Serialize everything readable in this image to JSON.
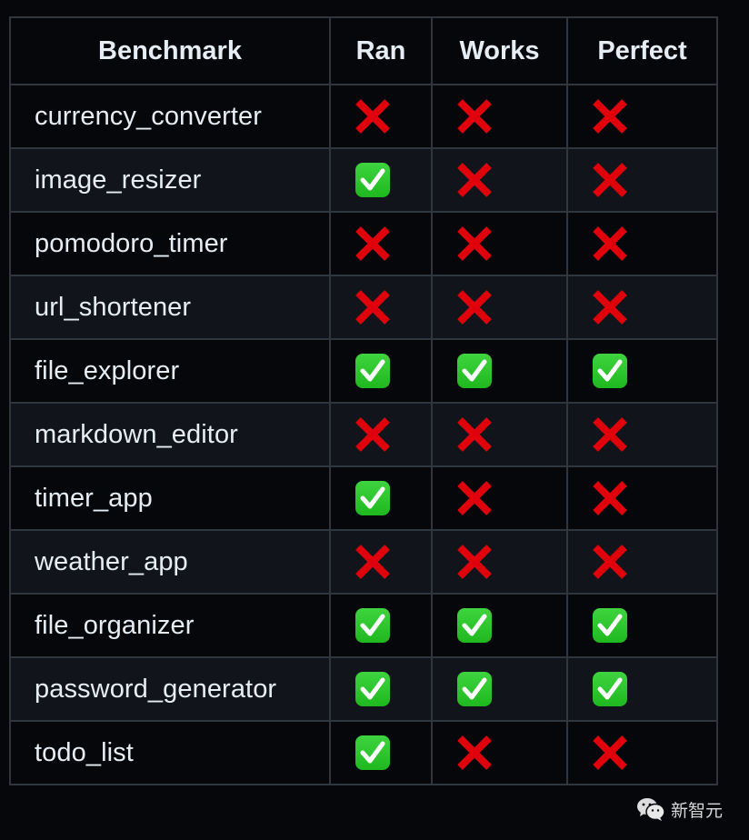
{
  "table": {
    "headers": [
      "Benchmark",
      "Ran",
      "Works",
      "Perfect"
    ],
    "rows": [
      {
        "benchmark": "currency_converter",
        "ran": "fail",
        "works": "fail",
        "perfect": "fail"
      },
      {
        "benchmark": "image_resizer",
        "ran": "pass",
        "works": "fail",
        "perfect": "fail"
      },
      {
        "benchmark": "pomodoro_timer",
        "ran": "fail",
        "works": "fail",
        "perfect": "fail"
      },
      {
        "benchmark": "url_shortener",
        "ran": "fail",
        "works": "fail",
        "perfect": "fail"
      },
      {
        "benchmark": "file_explorer",
        "ran": "pass",
        "works": "pass",
        "perfect": "pass"
      },
      {
        "benchmark": "markdown_editor",
        "ran": "fail",
        "works": "fail",
        "perfect": "fail"
      },
      {
        "benchmark": "timer_app",
        "ran": "pass",
        "works": "fail",
        "perfect": "fail"
      },
      {
        "benchmark": "weather_app",
        "ran": "fail",
        "works": "fail",
        "perfect": "fail"
      },
      {
        "benchmark": "file_organizer",
        "ran": "pass",
        "works": "pass",
        "perfect": "pass"
      },
      {
        "benchmark": "password_generator",
        "ran": "pass",
        "works": "pass",
        "perfect": "pass"
      },
      {
        "benchmark": "todo_list",
        "ran": "pass",
        "works": "fail",
        "perfect": "fail"
      }
    ]
  },
  "icons": {
    "pass": "white-heavy-check-mark-icon",
    "fail": "cross-mark-icon"
  },
  "colors": {
    "pass": "#1fb81f",
    "fail": "#e0000b",
    "background": "#05070b",
    "row_alt": "#11141b",
    "border": "#30363d",
    "text": "#e6edf3"
  },
  "watermark": {
    "icon": "wechat-icon",
    "text": "新智元"
  }
}
